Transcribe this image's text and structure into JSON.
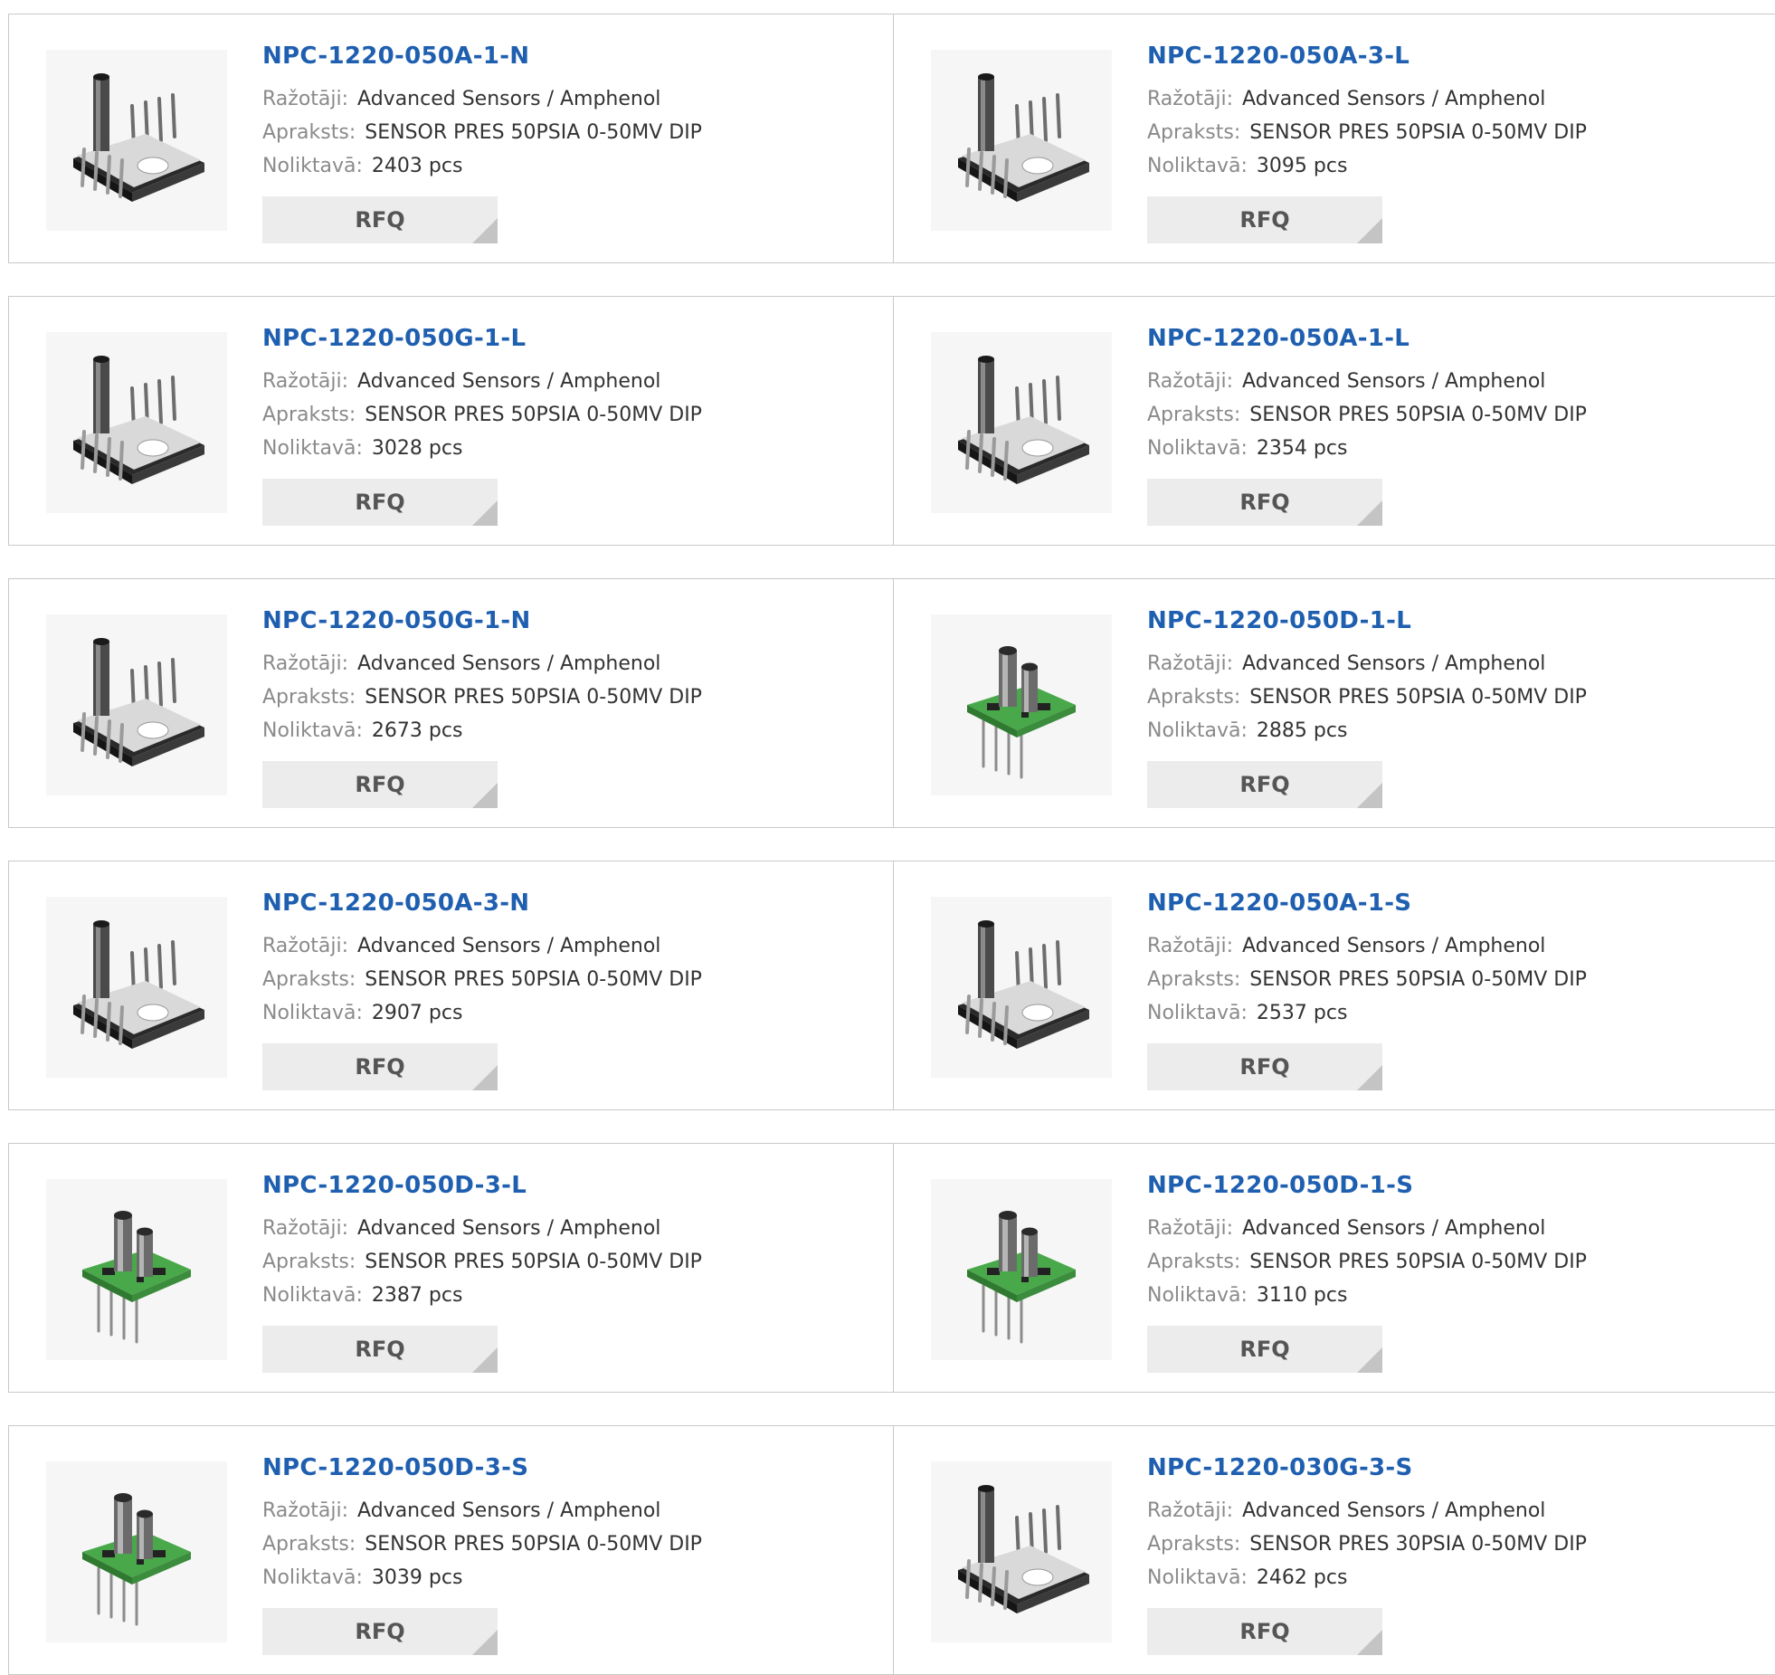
{
  "labels": {
    "manufacturer": "Ražotāji:",
    "description": "Apraksts:",
    "stock": "Noliktavā:",
    "rfq": "RFQ"
  },
  "colors": {
    "title": "#1f5fb0",
    "label": "#8a8a8a",
    "button_bg": "#ececec"
  },
  "products": [
    {
      "part": "NPC-1220-050A-1-N",
      "manufacturer": "Advanced Sensors / Amphenol",
      "description": "SENSOR PRES 50PSIA 0-50MV DIP",
      "stock": "2403 pcs",
      "image": "dip-sensor-single-port-icon"
    },
    {
      "part": "NPC-1220-050A-3-L",
      "manufacturer": "Advanced Sensors / Amphenol",
      "description": "SENSOR PRES 50PSIA 0-50MV DIP",
      "stock": "3095 pcs",
      "image": "dip-sensor-single-port-icon"
    },
    {
      "part": "NPC-1220-050G-1-L",
      "manufacturer": "Advanced Sensors / Amphenol",
      "description": "SENSOR PRES 50PSIA 0-50MV DIP",
      "stock": "3028 pcs",
      "image": "dip-sensor-single-port-icon"
    },
    {
      "part": "NPC-1220-050A-1-L",
      "manufacturer": "Advanced Sensors / Amphenol",
      "description": "SENSOR PRES 50PSIA 0-50MV DIP",
      "stock": "2354 pcs",
      "image": "dip-sensor-single-port-icon"
    },
    {
      "part": "NPC-1220-050G-1-N",
      "manufacturer": "Advanced Sensors / Amphenol",
      "description": "SENSOR PRES 50PSIA 0-50MV DIP",
      "stock": "2673 pcs",
      "image": "dip-sensor-single-port-icon"
    },
    {
      "part": "NPC-1220-050D-1-L",
      "manufacturer": "Advanced Sensors / Amphenol",
      "description": "SENSOR PRES 50PSIA 0-50MV DIP",
      "stock": "2885 pcs",
      "image": "dual-port-pcb-sensor-icon"
    },
    {
      "part": "NPC-1220-050A-3-N",
      "manufacturer": "Advanced Sensors / Amphenol",
      "description": "SENSOR PRES 50PSIA 0-50MV DIP",
      "stock": "2907 pcs",
      "image": "dip-sensor-single-port-icon"
    },
    {
      "part": "NPC-1220-050A-1-S",
      "manufacturer": "Advanced Sensors / Amphenol",
      "description": "SENSOR PRES 50PSIA 0-50MV DIP",
      "stock": "2537 pcs",
      "image": "dip-sensor-single-port-icon"
    },
    {
      "part": "NPC-1220-050D-3-L",
      "manufacturer": "Advanced Sensors / Amphenol",
      "description": "SENSOR PRES 50PSIA 0-50MV DIP",
      "stock": "2387 pcs",
      "image": "dual-port-pcb-sensor-icon"
    },
    {
      "part": "NPC-1220-050D-1-S",
      "manufacturer": "Advanced Sensors / Amphenol",
      "description": "SENSOR PRES 50PSIA 0-50MV DIP",
      "stock": "3110 pcs",
      "image": "dual-port-pcb-sensor-icon"
    },
    {
      "part": "NPC-1220-050D-3-S",
      "manufacturer": "Advanced Sensors / Amphenol",
      "description": "SENSOR PRES 50PSIA 0-50MV DIP",
      "stock": "3039 pcs",
      "image": "dual-port-pcb-sensor-icon"
    },
    {
      "part": "NPC-1220-030G-3-S",
      "manufacturer": "Advanced Sensors / Amphenol",
      "description": "SENSOR PRES 30PSIA 0-50MV DIP",
      "stock": "2462 pcs",
      "image": "dip-sensor-single-port-icon"
    }
  ]
}
